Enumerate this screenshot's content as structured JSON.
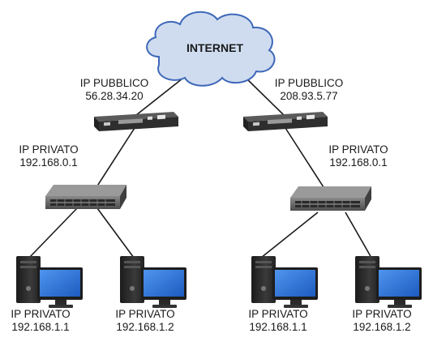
{
  "internet": {
    "label": "INTERNET"
  },
  "networks": [
    {
      "router": {
        "label": "IP PUBBLICO",
        "ip": "56.28.34.20"
      },
      "lan": {
        "label": "IP PRIVATO",
        "ip": "192.168.0.1"
      },
      "hosts": [
        {
          "label": "IP PRIVATO",
          "ip": "192.168.1.1"
        },
        {
          "label": "IP PRIVATO",
          "ip": "192.168.1.2"
        }
      ]
    },
    {
      "router": {
        "label": "IP PUBBLICO",
        "ip": "208.93.5.77"
      },
      "lan": {
        "label": "IP PRIVATO",
        "ip": "192.168.0.1"
      },
      "hosts": [
        {
          "label": "IP PRIVATO",
          "ip": "192.168.1.1"
        },
        {
          "label": "IP PRIVATO",
          "ip": "192.168.1.2"
        }
      ]
    }
  ],
  "colors": {
    "cloud_fill": "#cfdcf0",
    "cloud_stroke": "#3e68b8",
    "device_dark": "#2b2b2b",
    "switch_body": "#6e6e6e",
    "monitor_screen": "#2a6fd1",
    "link_line": "#1a1a1a"
  }
}
